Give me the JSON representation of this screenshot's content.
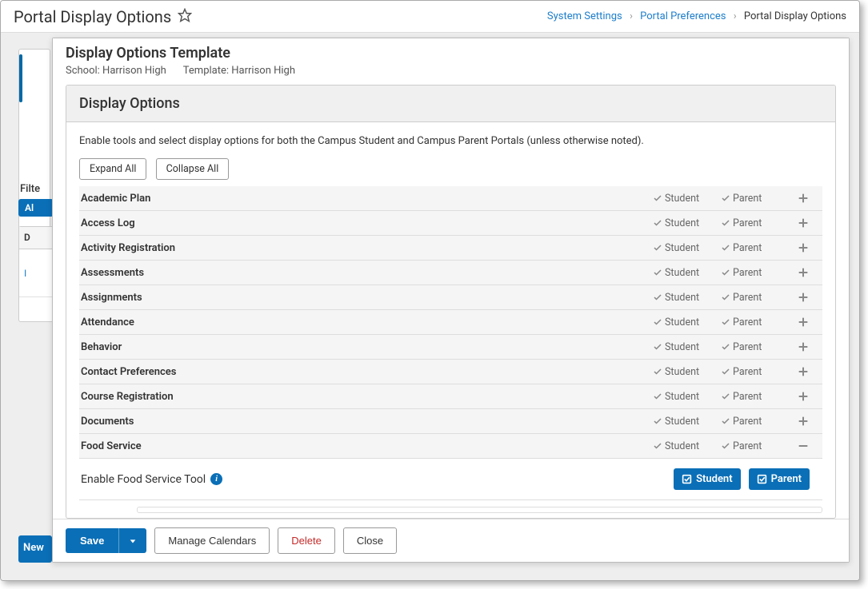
{
  "header": {
    "title": "Portal Display Options"
  },
  "breadcrumb": {
    "items": [
      {
        "label": "System Settings",
        "link": true
      },
      {
        "label": "Portal Preferences",
        "link": true
      },
      {
        "label": "Portal Display Options",
        "link": false
      }
    ]
  },
  "sidebar_bg": {
    "filter_label": "Filte",
    "pill": "Al",
    "col_header": "D",
    "row_value": "I",
    "new_btn": "New"
  },
  "modal": {
    "title": "Display Options Template",
    "school_label": "School: Harrison High",
    "template_label": "Template: Harrison High"
  },
  "card": {
    "title": "Display Options",
    "intro": "Enable tools and select display options for both the Campus Student and Campus Parent Portals (unless otherwise noted).",
    "expand_all": "Expand All",
    "collapse_all": "Collapse All"
  },
  "roles": {
    "student": "Student",
    "parent": "Parent"
  },
  "options": [
    {
      "label": "Academic Plan",
      "expanded": false
    },
    {
      "label": "Access Log",
      "expanded": false
    },
    {
      "label": "Activity Registration",
      "expanded": false
    },
    {
      "label": "Assessments",
      "expanded": false
    },
    {
      "label": "Assignments",
      "expanded": false
    },
    {
      "label": "Attendance",
      "expanded": false
    },
    {
      "label": "Behavior",
      "expanded": false
    },
    {
      "label": "Contact Preferences",
      "expanded": false
    },
    {
      "label": "Course Registration",
      "expanded": false
    },
    {
      "label": "Documents",
      "expanded": false
    },
    {
      "label": "Food Service",
      "expanded": true
    }
  ],
  "expanded_sub": {
    "label": "Enable Food Service Tool",
    "student_toggle": "Student",
    "parent_toggle": "Parent"
  },
  "footer": {
    "save": "Save",
    "manage_calendars": "Manage Calendars",
    "delete": "Delete",
    "close": "Close"
  }
}
